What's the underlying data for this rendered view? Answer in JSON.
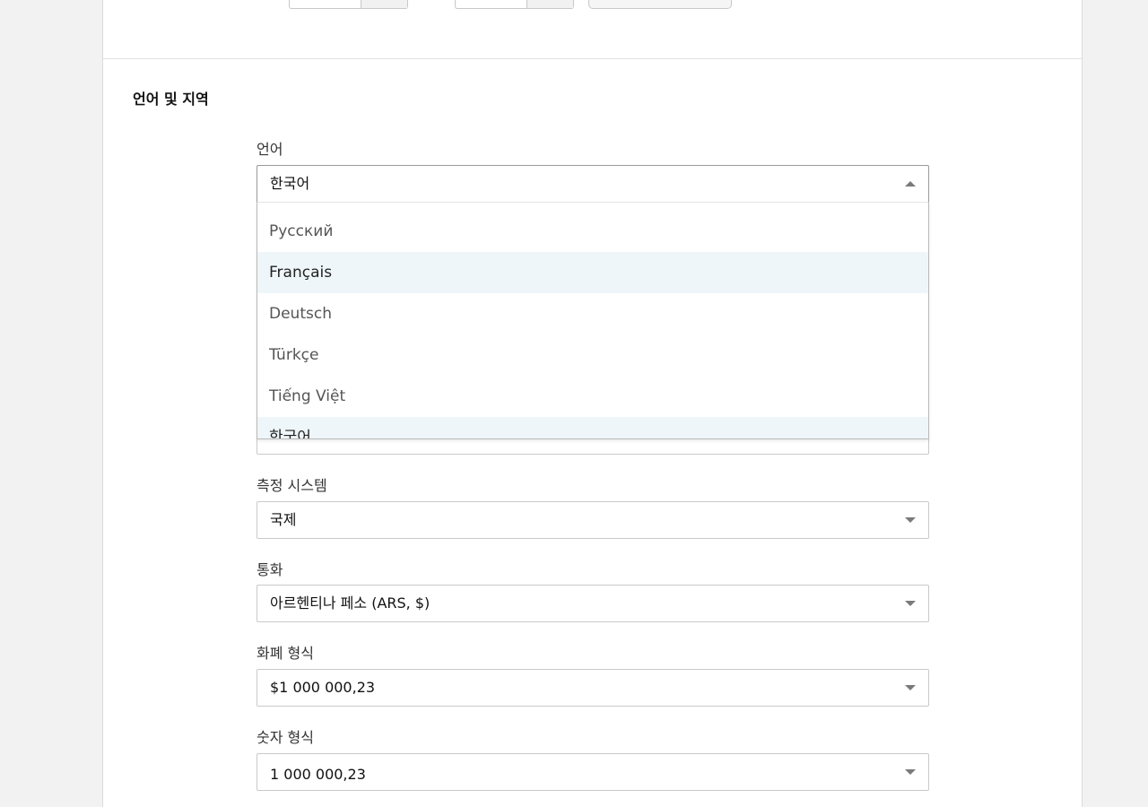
{
  "section": {
    "title": "언어 및 지역"
  },
  "language": {
    "label": "언어",
    "value": "한국어",
    "options": [
      "Русский",
      "Français",
      "Deutsch",
      "Türkçe",
      "Tiếng Việt",
      "한국어"
    ]
  },
  "measurement": {
    "label": "측정 시스템",
    "value": "국제"
  },
  "currency": {
    "label": "통화",
    "value": "아르헨티나 페소 (ARS, $)"
  },
  "currency_format": {
    "label": "화폐 형식",
    "value": "$1 000 000,23"
  },
  "number_format": {
    "label": "숫자 형식",
    "value": "1 000 000,23"
  }
}
